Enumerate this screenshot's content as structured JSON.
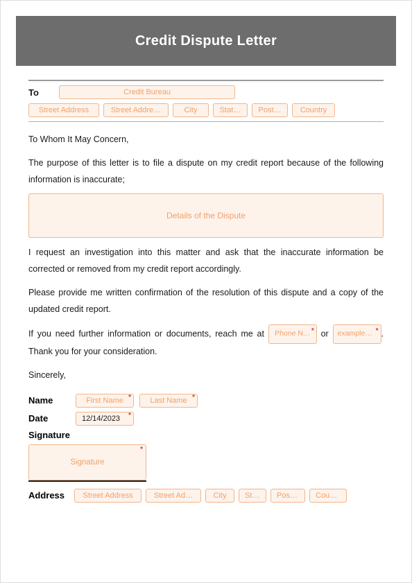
{
  "header": {
    "title": "Credit Dispute Letter"
  },
  "toSection": {
    "label": "To",
    "creditBureau": "Credit Bureau",
    "address": {
      "street1": "Street Address",
      "street2": "Street Addre…",
      "city": "City",
      "state": "Stat…",
      "post": "Post…",
      "country": "Country"
    }
  },
  "body": {
    "salutation": "To Whom It May Concern,",
    "p1": "The purpose of this letter is to file a dispute on my credit report because of the following information is inaccurate;",
    "detailsPlaceholder": "Details of the Dispute",
    "p2": "I request an investigation into this matter and ask that the inaccurate information be corrected or removed from my credit report accordingly.",
    "p3": "Please provide me written confirmation of the resolution of this dispute and a copy of the updated credit report.",
    "p4a": "If you need further information or documents, reach me at",
    "phone": "Phone N…",
    "p4b": "or",
    "email": "example@…",
    "p4c": ". Thank you for your consideration.",
    "closing": "Sincerely,"
  },
  "sig": {
    "nameLabel": "Name",
    "firstName": "First Name",
    "lastName": "Last Name",
    "dateLabel": "Date",
    "dateValue": "12/14/2023",
    "signatureLabel": "Signature",
    "signaturePlaceholder": "Signature",
    "addressLabel": "Address",
    "address": {
      "street1": "Street Address",
      "street2": "Street Ad…",
      "city": "City",
      "state": "Sta…",
      "post": "Post…",
      "country": "Coun…"
    }
  }
}
